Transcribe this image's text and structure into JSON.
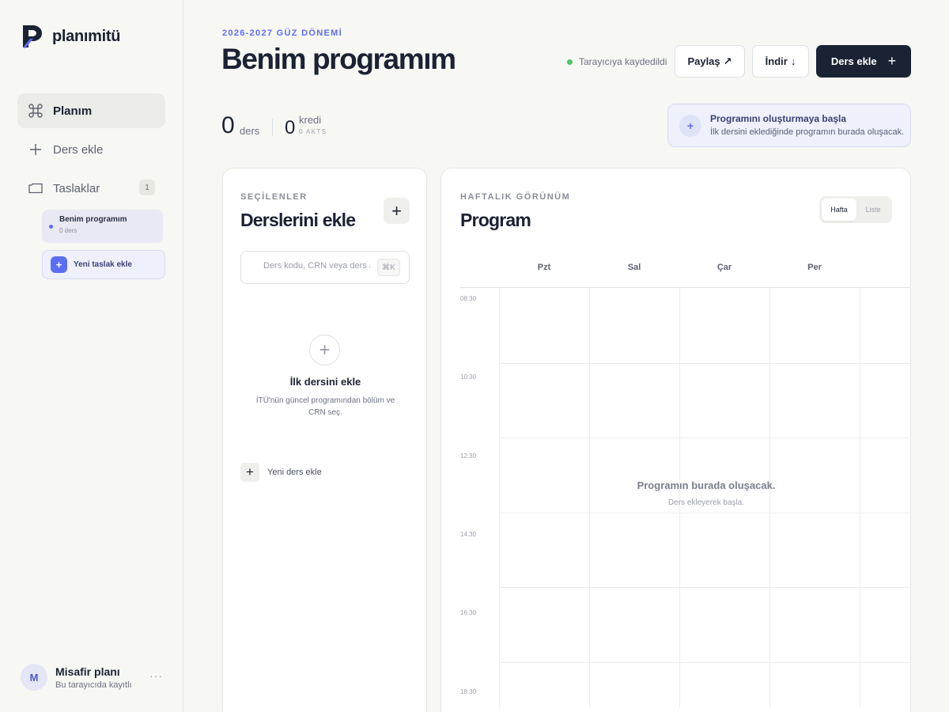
{
  "app": {
    "name": "planımitü"
  },
  "sidebar": {
    "items": [
      {
        "label": "Planım",
        "icon": "command-icon",
        "active": true
      },
      {
        "label": "Ders ekle",
        "icon": "plus-icon"
      },
      {
        "label": "Taslaklar",
        "icon": "folder-icon",
        "badge": "1"
      }
    ],
    "drafts": [
      {
        "title": "Benim programım",
        "subtitle": "0 ders"
      }
    ],
    "new_draft_label": "Yeni taslak ekle",
    "user": {
      "initial": "M",
      "name": "Misafir planı",
      "subtitle": "Bu tarayıcıda kayıtlı",
      "more": "···"
    }
  },
  "header": {
    "kicker": "2026-2027 GÜZ DÖNEMİ",
    "title": "Benim programım",
    "saved_status": "Tarayıcıya kaydedildi",
    "share_label": "Paylaş",
    "share_glyph": "↗",
    "download_label": "İndir",
    "download_glyph": "↓",
    "add_course_label": "Ders ekle",
    "add_course_glyph": "+"
  },
  "stats": {
    "courses_count": "0",
    "courses_label": "ders",
    "credits_count": "0",
    "credits_label": "kredi",
    "akts_label": "0 AKTS"
  },
  "hint": {
    "icon_glyph": "+",
    "title": "Programını oluşturmaya başla",
    "subtitle": "İlk dersini eklediğinde programın burada oluşacak."
  },
  "selected_panel": {
    "kicker": "SEÇİLENLER",
    "title": "Derslerini ekle",
    "add_glyph": "+",
    "search_placeholder": "Ders kodu, CRN veya ders adı",
    "search_value": "",
    "shortcut": "⌘K",
    "empty_glyph": "+",
    "empty_title": "İlk dersini ekle",
    "empty_subtitle": "İTÜ'nün güncel programından bölüm ve CRN seç.",
    "add_row_glyph": "+",
    "add_row_label": "Yeni ders ekle"
  },
  "schedule_panel": {
    "kicker": "HAFTALIK GÖRÜNÜM",
    "title": "Program",
    "view_options": [
      "Hafta",
      "Liste"
    ],
    "selected_view": "Hafta",
    "days": [
      "Pzt",
      "Sal",
      "Çar",
      "Per"
    ],
    "times": [
      "08:30",
      "10:30",
      "12:30",
      "14:30",
      "16:30",
      "18:30"
    ],
    "empty_title": "Programın burada oluşacak.",
    "empty_subtitle": "Ders ekleyerek başla."
  },
  "colors": {
    "accent": "#5b6ef2",
    "primary_dark": "#1b2233",
    "saved_green": "#4cc46b",
    "background": "#f7f7f4"
  }
}
